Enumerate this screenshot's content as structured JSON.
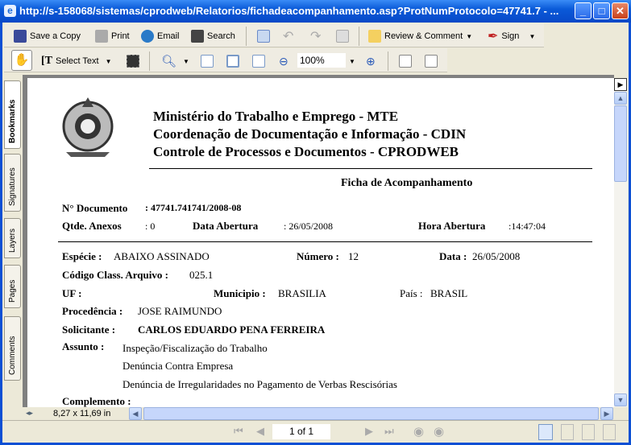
{
  "window": {
    "title": "http://s-158068/sistemas/cprodweb/Relatorios/fichadeacompanhamento.asp?ProtNumProtocolo=47741.7 - ..."
  },
  "toolbar1": {
    "save": "Save a Copy",
    "print": "Print",
    "email": "Email",
    "search": "Search",
    "review": "Review & Comment",
    "sign": "Sign"
  },
  "toolbar2": {
    "select_text": "Select Text",
    "zoom": "100%"
  },
  "nav_tabs": [
    "Bookmarks",
    "Signatures",
    "Layers",
    "Pages",
    "Comments"
  ],
  "document": {
    "header": [
      "Ministério do Trabalho e Emprego - MTE",
      "Coordenação de Documentação e Informação - CDIN",
      "Controle de Processos e Documentos - CPRODWEB"
    ],
    "form_title": "Ficha de Acompanhamento",
    "fields": {
      "doc_label": "N° Documento",
      "doc_value": ": 47741.741741/2008-08",
      "anexos_label": "Qtde. Anexos",
      "anexos_value": ":  0",
      "data_ab_label": "Data Abertura",
      "data_ab_value": ": 26/05/2008",
      "hora_label": "Hora Abertura",
      "hora_value": ":14:47:04",
      "especie_label": "Espécie :",
      "especie_value": "ABAIXO ASSINADO",
      "numero_label": "Número :",
      "numero_value": "12",
      "data_label": "Data :",
      "data_value": "26/05/2008",
      "codigo_label": "Código Class. Arquivo :",
      "codigo_value": "025.1",
      "uf_label": "UF :",
      "municipio_label": "Municipio :",
      "municipio_value": "BRASILIA",
      "pais_label": "País :",
      "pais_value": "BRASIL",
      "procedencia_label": "Procedência :",
      "procedencia_value": "JOSE RAIMUNDO",
      "solicitante_label": "Solicitante :",
      "solicitante_value": "CARLOS EDUARDO PENA FERREIRA",
      "assunto_label": "Assunto :",
      "assunto_values": [
        "Inspeção/Fiscalização do Trabalho",
        "Denúncia Contra Empresa",
        "Denúncia de Irregularidades no Pagamento de Verbas Rescisórias"
      ],
      "complemento_label": "Complemento :"
    }
  },
  "page_size": "8,27 x 11,69 in",
  "page_indicator": "1 of 1"
}
